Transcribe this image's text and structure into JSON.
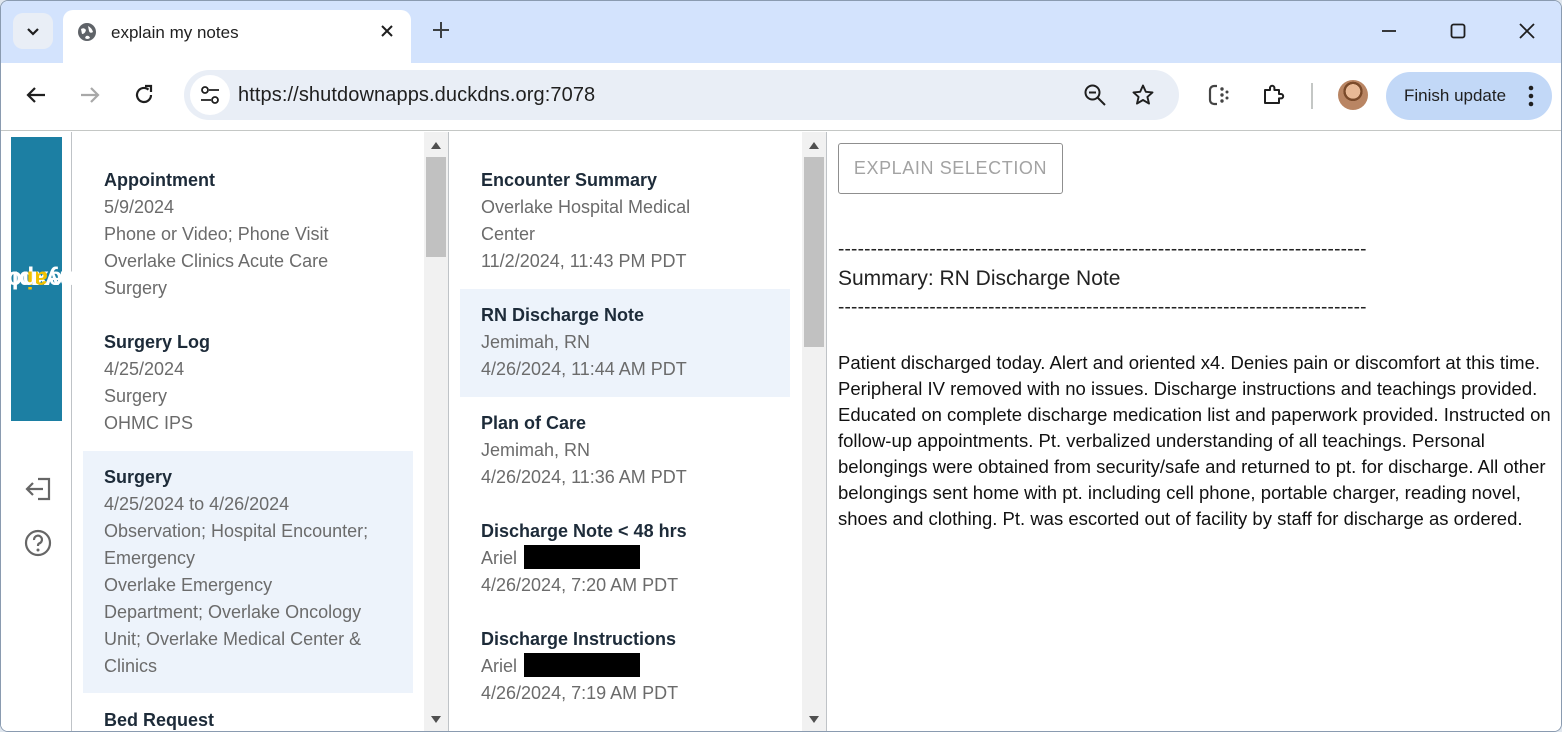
{
  "browser": {
    "tab_title": "explain my notes",
    "url": "https://shutdownapps.duckdns.org:7078",
    "update_label": "Finish update"
  },
  "logo": {
    "part1": "expl",
    "part2": "ai",
    "part3": "n my notes",
    "accent_color": "#f2c200",
    "bg_color": "#1c7fa3"
  },
  "encounters": [
    {
      "title": "Appointment",
      "lines": [
        "5/9/2024",
        "Phone or Video; Phone Visit",
        "Overlake Clinics Acute Care",
        "Surgery"
      ]
    },
    {
      "title": "Surgery Log",
      "lines": [
        "4/25/2024",
        "Surgery",
        "OHMC IPS"
      ]
    },
    {
      "title": "Surgery",
      "lines": [
        "4/25/2024 to 4/26/2024",
        "Observation; Hospital Encounter;",
        "Emergency",
        "Overlake Emergency",
        "Department; Overlake Oncology",
        "Unit; Overlake Medical Center &",
        "Clinics"
      ],
      "selected": true
    },
    {
      "title": "Bed Request"
    }
  ],
  "notes": [
    {
      "title": "Encounter Summary",
      "lines": [
        "Overlake Hospital Medical",
        "Center",
        "11/2/2024, 11:43 PM PDT"
      ]
    },
    {
      "title": "RN Discharge Note",
      "lines": [
        "Jemimah, RN",
        "4/26/2024, 11:44 AM PDT"
      ],
      "selected": true
    },
    {
      "title": "Plan of Care",
      "lines": [
        "Jemimah, RN",
        "4/26/2024, 11:36 AM PDT"
      ]
    },
    {
      "title": "Discharge Note < 48 hrs",
      "author": "Ariel",
      "date": "4/26/2024, 7:20 AM PDT"
    },
    {
      "title": "Discharge Instructions",
      "author": "Ariel",
      "date": "4/26/2024, 7:19 AM PDT"
    }
  ],
  "main": {
    "explain_label": "EXPLAIN SELECTION",
    "dashes": "---------------------------------------------------------------------------------",
    "summary_title": "Summary: RN Discharge Note",
    "note_text": "Patient discharged today. Alert and oriented x4. Denies pain or discomfort at this time. Peripheral IV removed with no issues. Discharge instructions and teachings provided. Educated on complete discharge medication list and paperwork provided. Instructed on follow-up appointments. Pt. verbalized understanding of all teachings. Personal belongings were obtained from security/safe and returned to pt. for discharge. All other belongings sent home with pt. including cell phone, portable charger, reading novel, shoes and clothing. Pt. was escorted out of facility by staff for discharge as ordered."
  },
  "icons": {
    "tab_search": "chevron-down-icon",
    "favicon": "globe-icon",
    "back": "arrow-left-icon",
    "forward": "arrow-right-icon",
    "reload": "reload-icon",
    "site_info": "tune-icon",
    "zoom": "zoom-out-icon",
    "bookmark": "star-icon",
    "extension1": "copilot-icon",
    "extensions": "puzzle-icon",
    "logout": "logout-icon",
    "help": "help-icon"
  }
}
